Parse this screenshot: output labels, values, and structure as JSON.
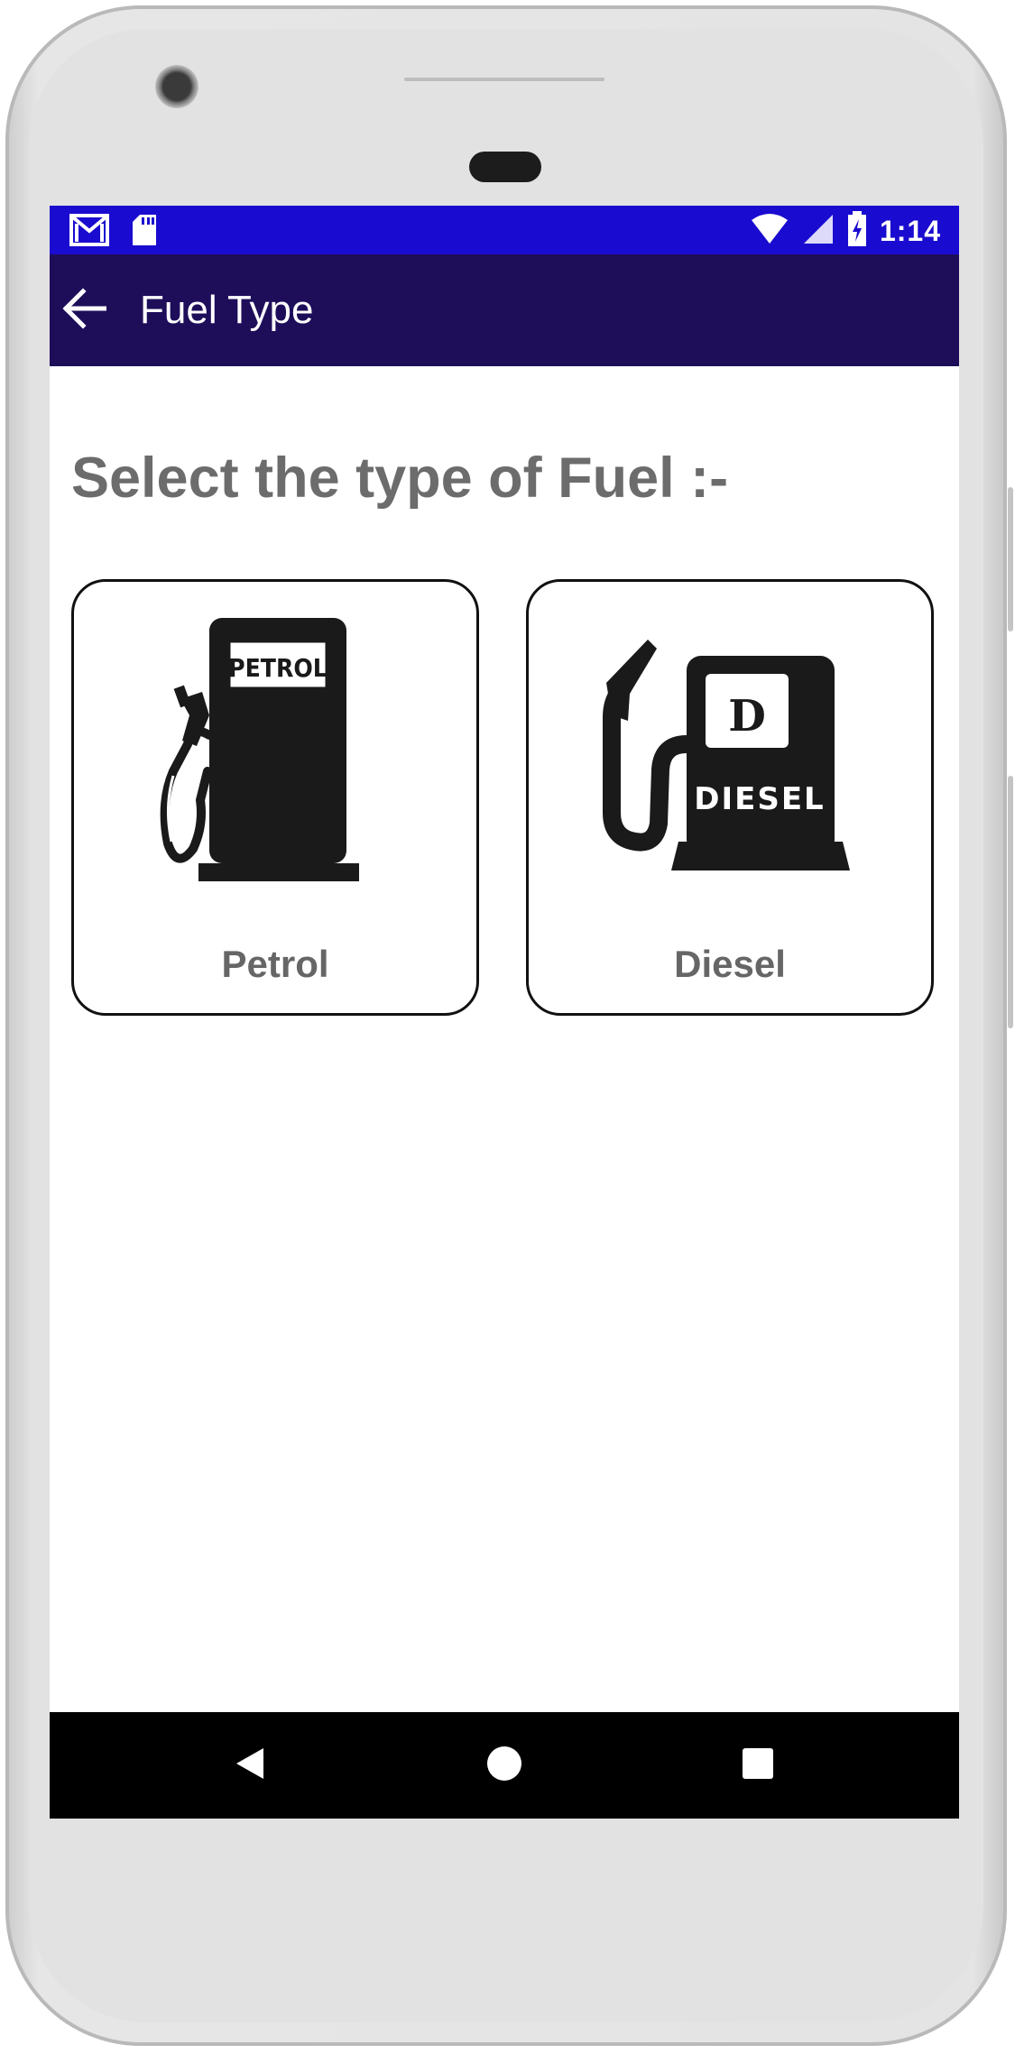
{
  "status_bar": {
    "time": "1:14",
    "left_icons": [
      "gmail-icon",
      "sd-card-icon"
    ],
    "right_icons": [
      "wifi-icon",
      "signal-icon",
      "battery-charging-icon"
    ]
  },
  "app_bar": {
    "title": "Fuel Type",
    "back_icon": "arrow-left-icon"
  },
  "main": {
    "heading": "Select the type of Fuel :-",
    "options": [
      {
        "label": "Petrol",
        "icon": "petrol-pump-icon",
        "icon_text": "PETROL"
      },
      {
        "label": "Diesel",
        "icon": "diesel-pump-icon",
        "icon_text_top": "D",
        "icon_text_bottom": "DIESEL"
      }
    ]
  },
  "nav_bar": {
    "buttons": [
      "back-triangle-icon",
      "home-circle-icon",
      "recents-square-icon"
    ]
  },
  "colors": {
    "status_bar": "#1a0bd0",
    "app_bar": "#1e0e5a",
    "heading_text": "#6c6c6c",
    "card_border": "#111111",
    "nav_bar": "#000000"
  }
}
